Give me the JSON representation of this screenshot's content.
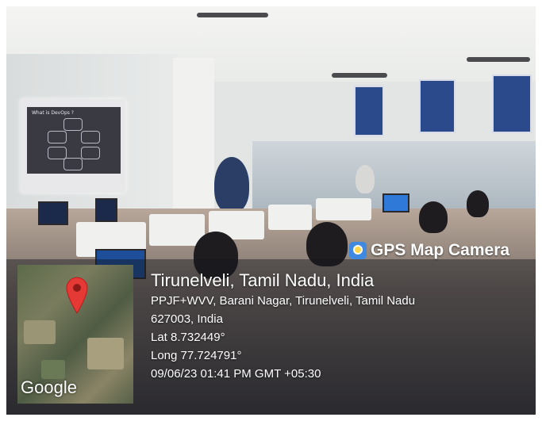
{
  "badge": {
    "label": "GPS Map Camera",
    "icon": "gps-map-camera-icon",
    "icon_color": "#3f8ae0"
  },
  "location": {
    "title": "Tirunelveli, Tamil Nadu, India",
    "address_line1": "PPJF+WVV, Barani Nagar, Tirunelveli, Tamil Nadu",
    "address_line2": "627003, India",
    "lat": "Lat 8.732449°",
    "long": "Long 77.724791°",
    "timestamp": "09/06/23 01:41 PM GMT +05:30"
  },
  "map": {
    "attribution": "Google",
    "pin_icon": "map-pin-icon",
    "pin_color": "#e53935"
  },
  "slide": {
    "heading": "What is DevOps ?"
  }
}
